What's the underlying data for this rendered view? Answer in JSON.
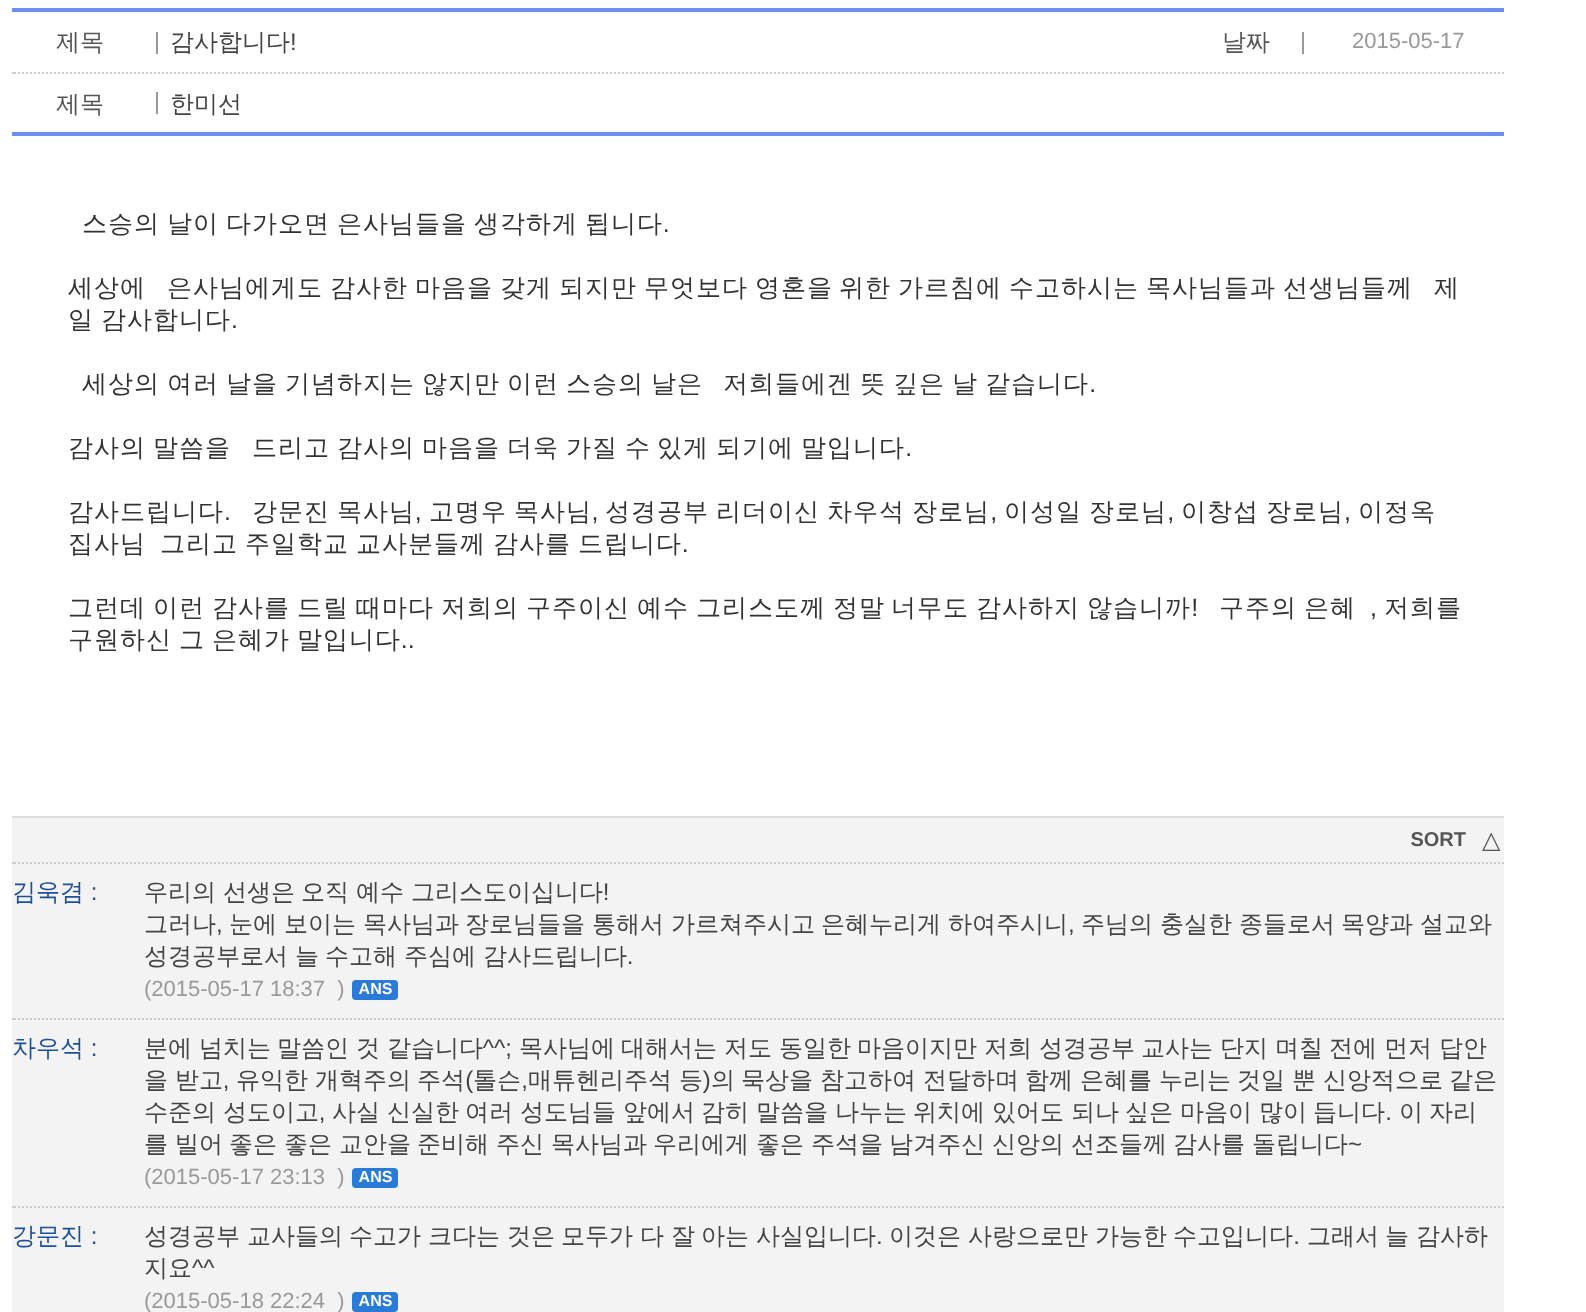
{
  "header": {
    "rows": [
      {
        "label": "제목",
        "value": "감사합니다!",
        "date_label": "날짜",
        "date": "2015-05-17"
      },
      {
        "label": "제목",
        "value": "한미선"
      }
    ]
  },
  "body": {
    "paragraphs": [
      "  스승의 날이 다가오면 은사님들을 생각하게 됩니다.",
      "세상에   은사님에게도 감사한 마음을 갖게 되지만 무엇보다 영혼을 위한 가르침에 수고하시는 목사님들과 선생님들께   제일 감사합니다.",
      "  세상의 여러 날을 기념하지는 않지만 이런 스승의 날은   저희들에겐 뜻 깊은 날 같습니다.",
      "감사의 말씀을   드리고 감사의 마음을 더욱 가질 수 있게 되기에 말입니다.",
      "감사드립니다.   강문진 목사님, 고명우 목사님, 성경공부 리더이신 차우석 장로님, 이성일 장로님, 이창섭 장로님, 이정옥 집사님  그리고 주일학교 교사분들께 감사를 드립니다.",
      "그런데 이런 감사를 드릴 때마다 저희의 구주이신 예수 그리스도께 정말 너무도 감사하지 않습니까!   구주의 은혜  , 저희를 구원하신 그 은혜가 말입니다.."
    ]
  },
  "comments": {
    "sort_label": "SORT",
    "sort_icon": "△",
    "items": [
      {
        "author": "김욱겸 :",
        "text": "우리의 선생은 오직 예수 그리스도이십니다!\n그러나, 눈에 보이는 목사님과 장로님들을 통해서 가르쳐주시고 은혜누리게 하여주시니, 주님의 충실한 종들로서 목양과 설교와 성경공부로서 늘 수고해 주심에 감사드립니다.",
        "date": "(2015-05-17 18:37  )",
        "badge": "ANS"
      },
      {
        "author": "차우석 :",
        "text": "분에 넘치는 말씀인 것 같습니다^^; 목사님에 대해서는 저도 동일한 마음이지만 저희 성경공부 교사는 단지 며칠 전에 먼저 답안을 받고, 유익한 개혁주의 주석(톨슨,매튜헨리주석 등)의 묵상을 참고하여 전달하며 함께 은혜를 누리는 것일 뿐 신앙적으로 같은 수준의 성도이고, 사실 신실한 여러 성도님들 앞에서 감히 말씀을 나누는 위치에 있어도 되나 싶은 마음이 많이 듭니다. 이 자리를 빌어 좋은 좋은 교안을 준비해 주신 목사님과 우리에게 좋은 주석을 남겨주신 신앙의 선조들께 감사를 돌립니다~",
        "date": "(2015-05-17 23:13  )",
        "badge": "ANS"
      },
      {
        "author": "강문진 :",
        "text": "성경공부 교사들의 수고가 크다는 것은 모두가 다 잘 아는 사실입니다. 이것은 사랑으로만 가능한 수고입니다. 그래서 늘 감사하지요^^",
        "date": "(2015-05-18 22:24  )",
        "badge": "ANS"
      }
    ]
  }
}
